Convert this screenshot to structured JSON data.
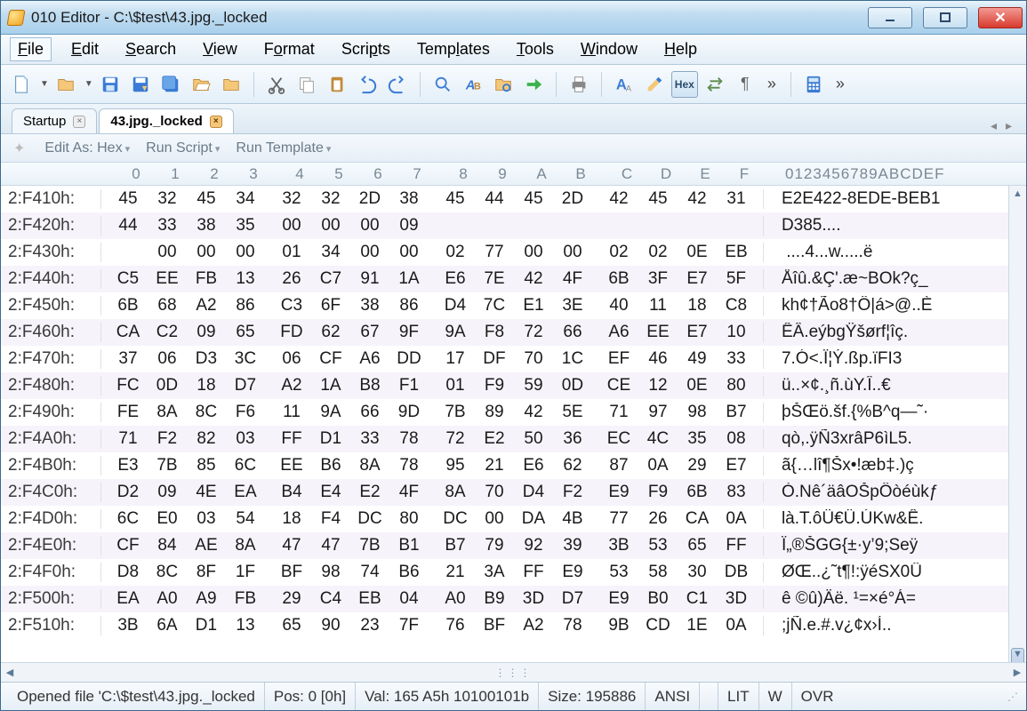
{
  "window": {
    "title": "010 Editor - C:\\$test\\43.jpg._locked"
  },
  "menu": [
    "File",
    "Edit",
    "Search",
    "View",
    "Format",
    "Scripts",
    "Templates",
    "Tools",
    "Window",
    "Help"
  ],
  "tabs": [
    {
      "label": "Startup",
      "active": false
    },
    {
      "label": "43.jpg._locked",
      "active": true
    }
  ],
  "secondary": {
    "edit_as_prefix": "Edit As: ",
    "edit_as_value": "Hex",
    "run_script": "Run Script",
    "run_template": "Run Template"
  },
  "col_headers_hex": [
    "0",
    "1",
    "2",
    "3",
    "4",
    "5",
    "6",
    "7",
    "8",
    "9",
    "A",
    "B",
    "C",
    "D",
    "E",
    "F"
  ],
  "col_headers_ascii": "0123456789ABCDEF",
  "rows": [
    {
      "addr": "2:F410h:",
      "hex": [
        "45",
        "32",
        "45",
        "34",
        "32",
        "32",
        "2D",
        "38",
        "45",
        "44",
        "45",
        "2D",
        "42",
        "45",
        "42",
        "31"
      ],
      "asc": "E2E422-8EDE-BEB1"
    },
    {
      "addr": "2:F420h:",
      "hex": [
        "44",
        "33",
        "38",
        "35",
        "00",
        "00",
        "00",
        "09",
        "",
        "",
        "",
        "",
        "",
        "",
        "",
        ""
      ],
      "asc": "D385...."
    },
    {
      "addr": "2:F430h:",
      "hex": [
        "",
        "00",
        "00",
        "00",
        "01",
        "34",
        "00",
        "00",
        "02",
        "77",
        "00",
        "00",
        "02",
        "02",
        "0E",
        "EB"
      ],
      "asc": " ....4...w.....ë"
    },
    {
      "addr": "2:F440h:",
      "hex": [
        "C5",
        "EE",
        "FB",
        "13",
        "26",
        "C7",
        "91",
        "1A",
        "E6",
        "7E",
        "42",
        "4F",
        "6B",
        "3F",
        "E7",
        "5F"
      ],
      "asc": "Åîû.&Ç'.æ~BOk?ç_"
    },
    {
      "addr": "2:F450h:",
      "hex": [
        "6B",
        "68",
        "A2",
        "86",
        "C3",
        "6F",
        "38",
        "86",
        "D4",
        "7C",
        "E1",
        "3E",
        "40",
        "11",
        "18",
        "C8"
      ],
      "asc": "kh¢†Ão8†Ô|á>@..È"
    },
    {
      "addr": "2:F460h:",
      "hex": [
        "CA",
        "C2",
        "09",
        "65",
        "FD",
        "62",
        "67",
        "9F",
        "9A",
        "F8",
        "72",
        "66",
        "A6",
        "EE",
        "E7",
        "10"
      ],
      "asc": "ÊÂ.eýbgŸšørf¦îç."
    },
    {
      "addr": "2:F470h:",
      "hex": [
        "37",
        "06",
        "D3",
        "3C",
        "06",
        "CF",
        "A6",
        "DD",
        "17",
        "DF",
        "70",
        "1C",
        "EF",
        "46",
        "49",
        "33"
      ],
      "asc": "7.Ó<.Ï¦Ý.ßp.ïFI3"
    },
    {
      "addr": "2:F480h:",
      "hex": [
        "FC",
        "0D",
        "18",
        "D7",
        "A2",
        "1A",
        "B8",
        "F1",
        "01",
        "F9",
        "59",
        "0D",
        "CE",
        "12",
        "0E",
        "80"
      ],
      "asc": "ü..×¢.¸ñ.ùY.Î..€"
    },
    {
      "addr": "2:F490h:",
      "hex": [
        "FE",
        "8A",
        "8C",
        "F6",
        "11",
        "9A",
        "66",
        "9D",
        "7B",
        "89",
        "42",
        "5E",
        "71",
        "97",
        "98",
        "B7"
      ],
      "asc": "þŠŒö.šf.{%B^q—˜·"
    },
    {
      "addr": "2:F4A0h:",
      "hex": [
        "71",
        "F2",
        "82",
        "03",
        "FF",
        "D1",
        "33",
        "78",
        "72",
        "E2",
        "50",
        "36",
        "EC",
        "4C",
        "35",
        "08"
      ],
      "asc": "qò,.ÿÑ3xrâP6ìL5."
    },
    {
      "addr": "2:F4B0h:",
      "hex": [
        "E3",
        "7B",
        "85",
        "6C",
        "EE",
        "B6",
        "8A",
        "78",
        "95",
        "21",
        "E6",
        "62",
        "87",
        "0A",
        "29",
        "E7"
      ],
      "asc": "ã{…lî¶Šx•!æb‡.)ç"
    },
    {
      "addr": "2:F4C0h:",
      "hex": [
        "D2",
        "09",
        "4E",
        "EA",
        "B4",
        "E4",
        "E2",
        "4F",
        "8A",
        "70",
        "D4",
        "F2",
        "E9",
        "F9",
        "6B",
        "83"
      ],
      "asc": "Ò.Nê´äâOŠpÔòéùkƒ"
    },
    {
      "addr": "2:F4D0h:",
      "hex": [
        "6C",
        "E0",
        "03",
        "54",
        "18",
        "F4",
        "DC",
        "80",
        "DC",
        "00",
        "DA",
        "4B",
        "77",
        "26",
        "CA",
        "0A"
      ],
      "asc": "là.T.ôÜ€Ü.ÚKw&Ê."
    },
    {
      "addr": "2:F4E0h:",
      "hex": [
        "CF",
        "84",
        "AE",
        "8A",
        "47",
        "47",
        "7B",
        "B1",
        "B7",
        "79",
        "92",
        "39",
        "3B",
        "53",
        "65",
        "FF"
      ],
      "asc": "Ï„®ŠGG{±·y’9;Seÿ"
    },
    {
      "addr": "2:F4F0h:",
      "hex": [
        "D8",
        "8C",
        "8F",
        "1F",
        "BF",
        "98",
        "74",
        "B6",
        "21",
        "3A",
        "FF",
        "E9",
        "53",
        "58",
        "30",
        "DB"
      ],
      "asc": "ØŒ..¿˜t¶!:ÿéSX0Û"
    },
    {
      "addr": "2:F500h:",
      "hex": [
        "EA",
        "A0",
        "A9",
        "FB",
        "29",
        "C4",
        "EB",
        "04",
        "A0",
        "B9",
        "3D",
        "D7",
        "E9",
        "B0",
        "C1",
        "3D"
      ],
      "asc": "ê ©û)Äë. ¹=×é°Á="
    },
    {
      "addr": "2:F510h:",
      "hex": [
        "3B",
        "6A",
        "D1",
        "13",
        "65",
        "90",
        "23",
        "7F",
        "76",
        "BF",
        "A2",
        "78",
        "9B",
        "CD",
        "1E",
        "0A"
      ],
      "asc": ";jÑ.e.#.v¿¢x›Í.."
    }
  ],
  "status": {
    "opened": "Opened file 'C:\\$test\\43.jpg._locked",
    "pos": "Pos: 0 [0h]",
    "val": "Val: 165 A5h 10100101b",
    "size": "Size: 195886",
    "enc": "ANSI",
    "lit": "LIT",
    "w": "W",
    "ovr": "OVR"
  }
}
